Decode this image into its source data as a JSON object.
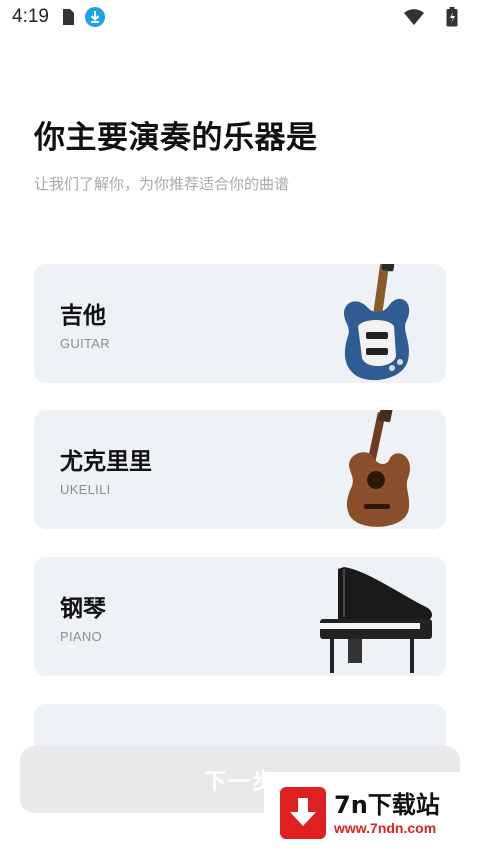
{
  "status_bar": {
    "time": "4:19",
    "icons": [
      "sim-icon",
      "download-icon",
      "wifi-icon",
      "battery-icon"
    ]
  },
  "header": {
    "title": "你主要演奏的乐器是",
    "subtitle": "让我们了解你，为你推荐适合你的曲谱"
  },
  "instruments": [
    {
      "name": "吉他",
      "sub": "GUITAR",
      "icon": "guitar-icon"
    },
    {
      "name": "尤克里里",
      "sub": "UKELILI",
      "icon": "ukulele-icon"
    },
    {
      "name": "钢琴",
      "sub": "PIANO",
      "icon": "piano-icon"
    }
  ],
  "footer": {
    "next_label": "下一步"
  },
  "watermark": {
    "title": "7n下载站",
    "url": "www.7ndn.com"
  },
  "colors": {
    "card_bg": "#eef2f6",
    "button_bg": "#e9e9e9",
    "watermark_red": "#e02020",
    "download_badge": "#1ea0e6"
  }
}
